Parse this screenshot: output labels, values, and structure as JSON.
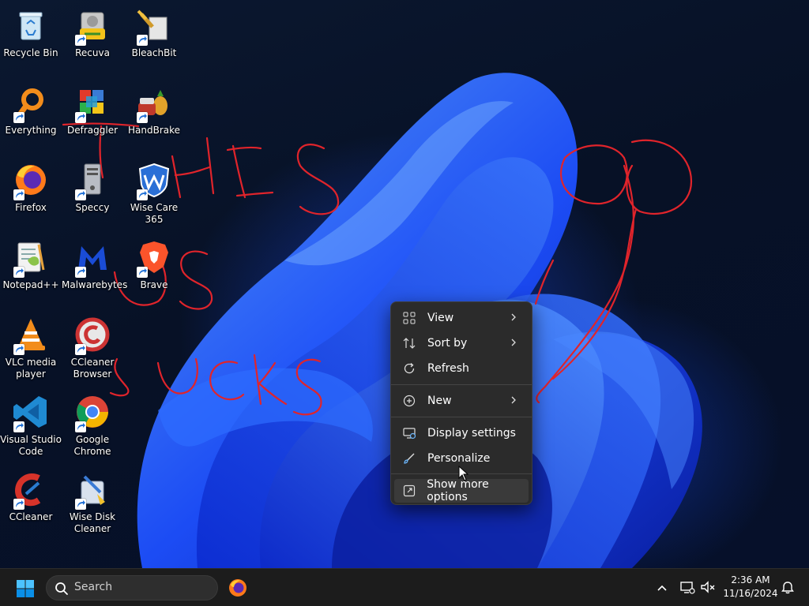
{
  "desktop_icons": [
    {
      "label": "Recycle Bin",
      "icon": "recycle-bin-icon"
    },
    {
      "label": "Recuva",
      "icon": "recuva-icon"
    },
    {
      "label": "BleachBit",
      "icon": "bleachbit-icon"
    },
    {
      "label": "Everything",
      "icon": "everything-icon"
    },
    {
      "label": "Defraggler",
      "icon": "defraggler-icon"
    },
    {
      "label": "HandBrake",
      "icon": "handbrake-icon"
    },
    {
      "label": "Firefox",
      "icon": "firefox-icon"
    },
    {
      "label": "Speccy",
      "icon": "speccy-icon"
    },
    {
      "label": "Wise Care 365",
      "icon": "wise-care-icon"
    },
    {
      "label": "Notepad++",
      "icon": "notepadpp-icon"
    },
    {
      "label": "Malwarebytes",
      "icon": "malwarebytes-icon"
    },
    {
      "label": "Brave",
      "icon": "brave-icon"
    },
    {
      "label": "VLC media player",
      "icon": "vlc-icon"
    },
    {
      "label": "CCleaner Browser",
      "icon": "ccleaner-browser-icon"
    },
    {
      "label": "Visual Studio Code",
      "icon": "vscode-icon"
    },
    {
      "label": "Google Chrome",
      "icon": "chrome-icon"
    },
    {
      "label": "CCleaner",
      "icon": "ccleaner-icon"
    },
    {
      "label": "Wise Disk Cleaner",
      "icon": "wise-disk-cleaner-icon"
    }
  ],
  "context_menu": {
    "items": [
      {
        "label": "View",
        "icon": "view-grid-icon",
        "submenu": true
      },
      {
        "label": "Sort by",
        "icon": "sort-icon",
        "submenu": true
      },
      {
        "label": "Refresh",
        "icon": "refresh-icon",
        "submenu": false
      },
      {
        "label": "New",
        "icon": "new-plus-icon",
        "submenu": true
      },
      {
        "label": "Display settings",
        "icon": "display-icon",
        "submenu": false
      },
      {
        "label": "Personalize",
        "icon": "brush-icon",
        "submenu": false
      },
      {
        "label": "Show more options",
        "icon": "more-options-icon",
        "submenu": false
      }
    ],
    "hovered": "Show more options"
  },
  "taskbar": {
    "search_label": "Search",
    "pinned": [
      "firefox-icon"
    ],
    "clock": {
      "time": "2:36 AM",
      "date": "11/16/2024"
    }
  },
  "colors": {
    "menu_bg": "#2b2b2b",
    "taskbar_bg": "#1c1c1c",
    "scribble": "#e0242b",
    "wallpaper_blue": "#1e50ff"
  }
}
